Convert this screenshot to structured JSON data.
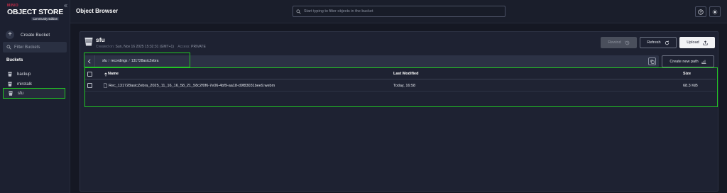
{
  "sidebar": {
    "logo": {
      "brand": "MINIO",
      "title": "OBJECT STORE",
      "edition": "Community Edition"
    },
    "create_bucket": "Create Bucket",
    "filter_placeholder": "Filter Buckets",
    "buckets_heading": "Buckets",
    "buckets": [
      {
        "label": "backup",
        "active": false
      },
      {
        "label": "mirotalk",
        "active": false
      },
      {
        "label": "sfu",
        "active": true
      }
    ]
  },
  "header": {
    "title": "Object Browser",
    "search_placeholder": "Start typing to filter objects in the bucket"
  },
  "bucket": {
    "name": "sfu",
    "created_label": "Created on:",
    "created_value": "Sun, Nov 16 2025 15:32:31 (GMT+1)",
    "access_label": "Access:",
    "access_value": "PRIVATE",
    "buttons": {
      "rewind": "Rewind",
      "refresh": "Refresh",
      "upload": "Upload"
    }
  },
  "breadcrumb": [
    "sfu",
    "recordings",
    "131728asicZebra"
  ],
  "create_path": "Create new path",
  "table": {
    "columns": {
      "name": "Name",
      "last_modified": "Last Modified",
      "size": "Size"
    },
    "rows": [
      {
        "name": "Rec_131728asicZebra_2025_11_16_16_58_21_58c2f0f6-7e06-4bf9-aa18-d9f83031bee9.webm",
        "last_modified": "Today, 16:58",
        "size": "68.3 KiB"
      }
    ]
  },
  "colors": {
    "highlight": "#22c524",
    "background": "#151823",
    "panel": "#1e2232",
    "brand": "#c72c48"
  }
}
